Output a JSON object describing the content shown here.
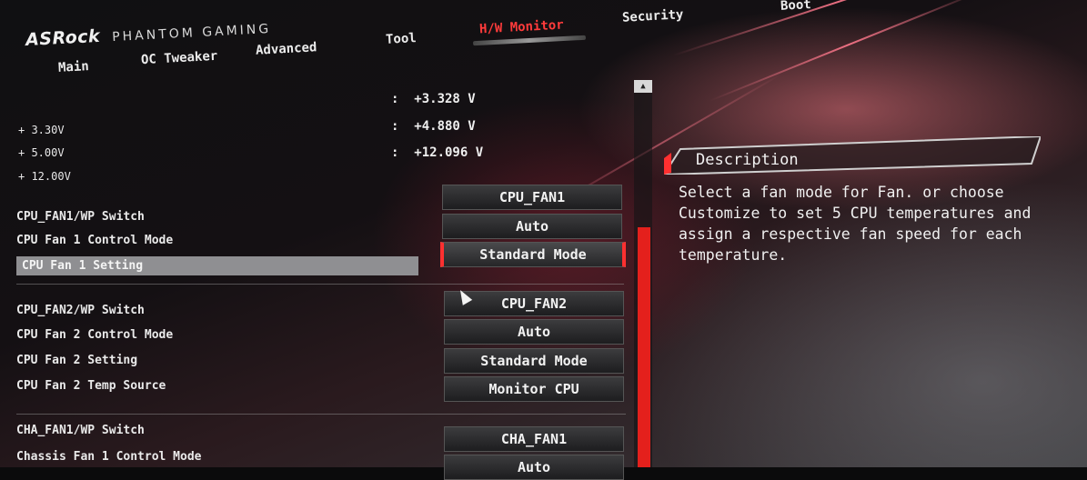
{
  "header": {
    "brand": "ASRock",
    "brand_sub": "PHANTOM GAMING",
    "tabs": [
      {
        "label": "Main"
      },
      {
        "label": "OC Tweaker"
      },
      {
        "label": "Advanced"
      },
      {
        "label": "Tool"
      },
      {
        "label": "H/W Monitor",
        "active": true
      },
      {
        "label": "Security"
      },
      {
        "label": "Boot"
      }
    ]
  },
  "voltages": {
    "labels": [
      "+ 3.30V",
      "+ 5.00V",
      "+ 12.00V"
    ],
    "values": [
      ":  +3.328 V",
      ":  +4.880 V",
      ":  +12.096 V"
    ]
  },
  "settings": [
    {
      "label": "CPU_FAN1/WP Switch",
      "value": "CPU_FAN1"
    },
    {
      "label": "CPU Fan 1 Control Mode",
      "value": "Auto"
    },
    {
      "label": "CPU Fan 1 Setting",
      "value": "Standard Mode",
      "selected": true
    },
    {
      "label": "CPU_FAN2/WP Switch",
      "value": "CPU_FAN2"
    },
    {
      "label": "CPU Fan 2 Control Mode",
      "value": "Auto"
    },
    {
      "label": "CPU Fan 2 Setting",
      "value": "Standard Mode"
    },
    {
      "label": "CPU Fan 2 Temp Source",
      "value": "Monitor CPU"
    },
    {
      "label": "CHA_FAN1/WP Switch",
      "value": "CHA_FAN1"
    },
    {
      "label": "Chassis Fan 1 Control Mode",
      "value": "Auto"
    }
  ],
  "description": {
    "title": "Description",
    "text": "Select a fan mode for Fan. or choose Customize to set 5 CPU temperatures and assign a respective fan speed for each temperature."
  },
  "icons": {
    "scroll_up": "scroll-up-arrow-icon",
    "cursor": "mouse-pointer-icon"
  },
  "colors": {
    "accent": "#ff3030",
    "selected_row": "#8f8f92"
  }
}
